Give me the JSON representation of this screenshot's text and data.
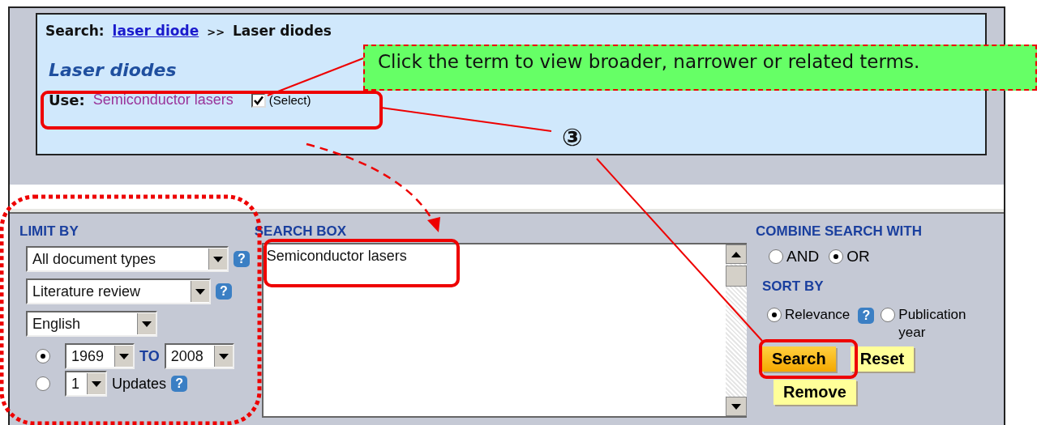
{
  "breadcrumb": {
    "label": "Search:",
    "link": "laser diode",
    "separator": ">>",
    "current": "Laser diodes"
  },
  "heading": "Laser diodes",
  "use_row": {
    "label": "Use:",
    "term": "Semiconductor lasers",
    "checked": true,
    "select_label": "(Select)"
  },
  "callout": "Click the term to view broader, narrower or related terms.",
  "step_marker": "③",
  "limit_by": {
    "title": "LIMIT BY",
    "dropdowns": [
      {
        "value": "All document types",
        "help": "?"
      },
      {
        "value": "Literature review",
        "help": "?"
      },
      {
        "value": "English"
      }
    ],
    "range": {
      "selected": true,
      "from": "1969",
      "to_label": "TO",
      "to": "2008"
    },
    "updates": {
      "selected": false,
      "value": "1",
      "label": "Updates",
      "help": "?"
    }
  },
  "search_box": {
    "title": "SEARCH BOX",
    "value": "Semiconductor lasers"
  },
  "combine": {
    "title": "COMBINE SEARCH WITH",
    "options": [
      {
        "label": "AND",
        "selected": false
      },
      {
        "label": "OR",
        "selected": true
      }
    ]
  },
  "sort": {
    "title": "SORT BY",
    "options": [
      {
        "label": "Relevance",
        "selected": true,
        "help": "?"
      },
      {
        "label": "Publication year",
        "selected": false
      }
    ]
  },
  "buttons": [
    {
      "label": "Search",
      "kind": "primary"
    },
    {
      "label": "Reset",
      "kind": "secondary"
    },
    {
      "label": "Remove",
      "kind": "secondary"
    }
  ]
}
